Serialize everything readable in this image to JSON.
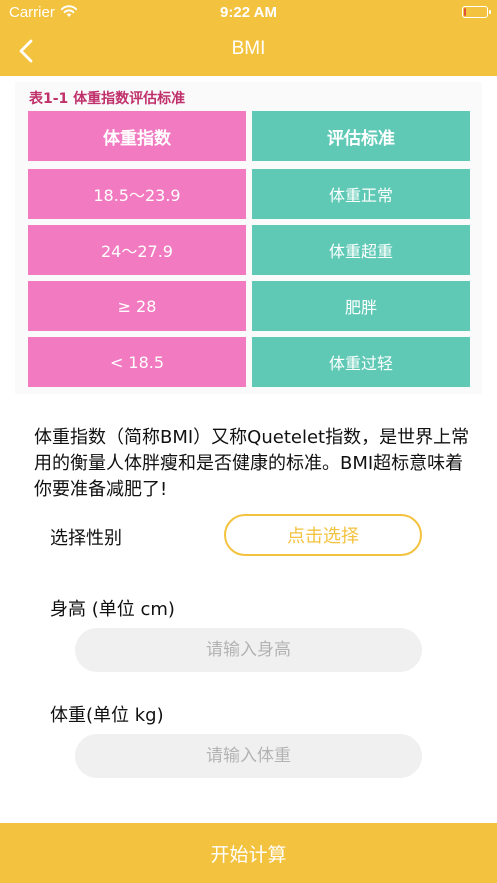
{
  "status_bar": {
    "carrier": "Carrier",
    "time": "9:22 AM",
    "battery_level": 0.1,
    "battery_color": "#e0533b"
  },
  "nav": {
    "title": "BMI",
    "back_icon": "chevron-left-icon"
  },
  "bmi_table": {
    "caption": "表1-1   体重指数评估标准",
    "headers": [
      "体重指数",
      "评估标准"
    ],
    "rows": [
      [
        "18.5～23.9",
        "体重正常"
      ],
      [
        "24～27.9",
        "体重超重"
      ],
      [
        "≥ 28",
        "肥胖"
      ],
      [
        "< 18.5",
        "体重过轻"
      ]
    ],
    "pink": "#f27ac1",
    "teal": "#5fc9b6"
  },
  "description": "体重指数（简称BMI）又称Quetelet指数，是世界上常用的衡量人体胖瘦和是否健康的标准。BMI超标意味着你要准备减肥了!",
  "form": {
    "gender_label": "选择性别",
    "gender_button": "点击选择",
    "height_label": "身高 (单位 cm)",
    "height_placeholder": "请输入身高",
    "height_value": "",
    "weight_label": "体重(单位 kg)",
    "weight_placeholder": "请输入体重",
    "weight_value": ""
  },
  "calculate_button": "开始计算",
  "accent_color": "#f3c23e"
}
